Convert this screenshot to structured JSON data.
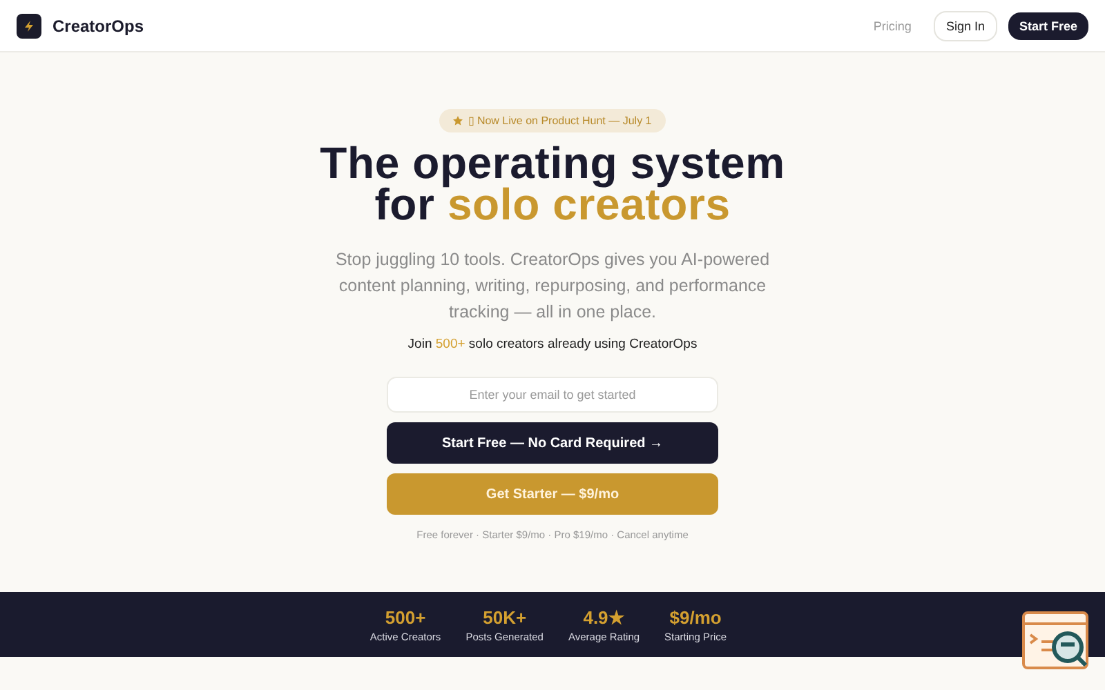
{
  "header": {
    "brand": "CreatorOps",
    "nav": [
      {
        "label": "Pricing",
        "kind": "link"
      },
      {
        "label": "Sign In",
        "kind": "outline"
      },
      {
        "label": "Start Free",
        "kind": "solid"
      }
    ]
  },
  "hero": {
    "badge": "▯ Now Live on Product Hunt — July 1",
    "title_line_1": "The operating system",
    "title_line_2": "for **solo creators**",
    "subtitle": "Stop juggling 10 tools. CreatorOps gives you AI-powered content planning, writing, repurposing, and performance tracking — all in one place.",
    "social_proof": "Join **500+** solo creators already using CreatorOps",
    "email_field": {
      "placeholder": "Enter your email to get started"
    },
    "buttons": [
      {
        "label": "Start Free — No Card Required →",
        "kind": "dark"
      },
      {
        "label": "Get Starter — $9/mo",
        "kind": "gold"
      }
    ],
    "pricing_note": "Free forever · Starter $9/mo · Pro $19/mo · Cancel anytime"
  },
  "stats": [
    {
      "value": "500+",
      "label": "Active Creators"
    },
    {
      "value": "50K+",
      "label": "Posts Generated"
    },
    {
      "value": "4.9★",
      "label": "Average Rating"
    },
    {
      "value": "$9/mo",
      "label": "Starting Price"
    }
  ]
}
